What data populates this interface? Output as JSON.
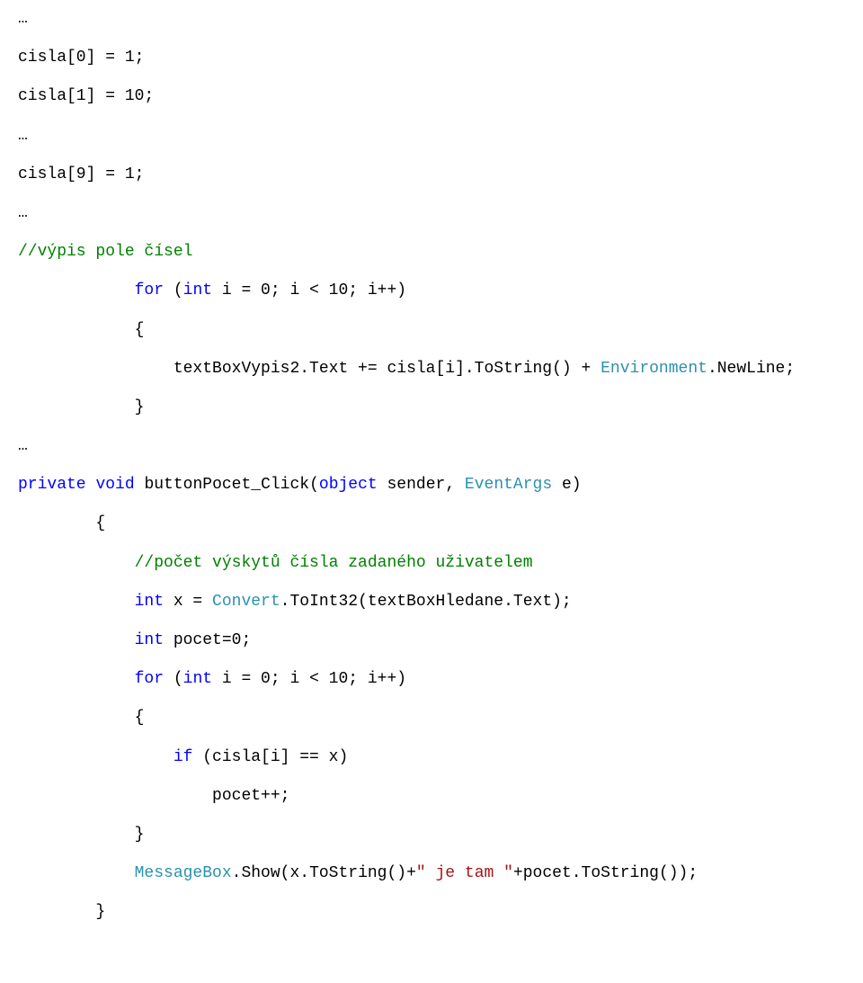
{
  "l01": "…",
  "l02": "cisla[0] = 1;",
  "l03": "cisla[1] = 10;",
  "l04": "…",
  "l05": "cisla[9] = 1;",
  "l06": "…",
  "l07": "//výpis pole čísel",
  "l08a": "            for",
  "l08b": " (",
  "l08c": "int",
  "l08d": " i = 0; i < 10; i++)",
  "l09": "            {",
  "l10a": "                textBoxVypis2.Text += cisla[i].ToString() + ",
  "l10b": "Environment",
  "l10c": ".NewLine;",
  "l11": "            }",
  "l12": "…",
  "l13a": "private",
  "l13b": " ",
  "l13c": "void",
  "l13d": " buttonPocet_Click(",
  "l13e": "object",
  "l13f": " sender, ",
  "l13g": "EventArgs",
  "l13h": " e)",
  "l14": "        {",
  "l15": "            //počet výskytů čísla zadaného uživatelem",
  "l16a": "            ",
  "l16b": "int",
  "l16c": " x = ",
  "l16d": "Convert",
  "l16e": ".ToInt32(textBoxHledane.Text);",
  "l17a": "            ",
  "l17b": "int",
  "l17c": " pocet=0;",
  "l18a": "            ",
  "l18b": "for",
  "l18c": " (",
  "l18d": "int",
  "l18e": " i = 0; i < 10; i++)",
  "l19": "            {",
  "l20a": "                ",
  "l20b": "if",
  "l20c": " (cisla[i] == x)",
  "l21": "                    pocet++;",
  "l22": "            }",
  "l23a": "            ",
  "l23b": "MessageBox",
  "l23c": ".Show(x.ToString()+",
  "l23d": "\" je tam \"",
  "l23e": "+pocet.ToString());",
  "l24": "        }"
}
